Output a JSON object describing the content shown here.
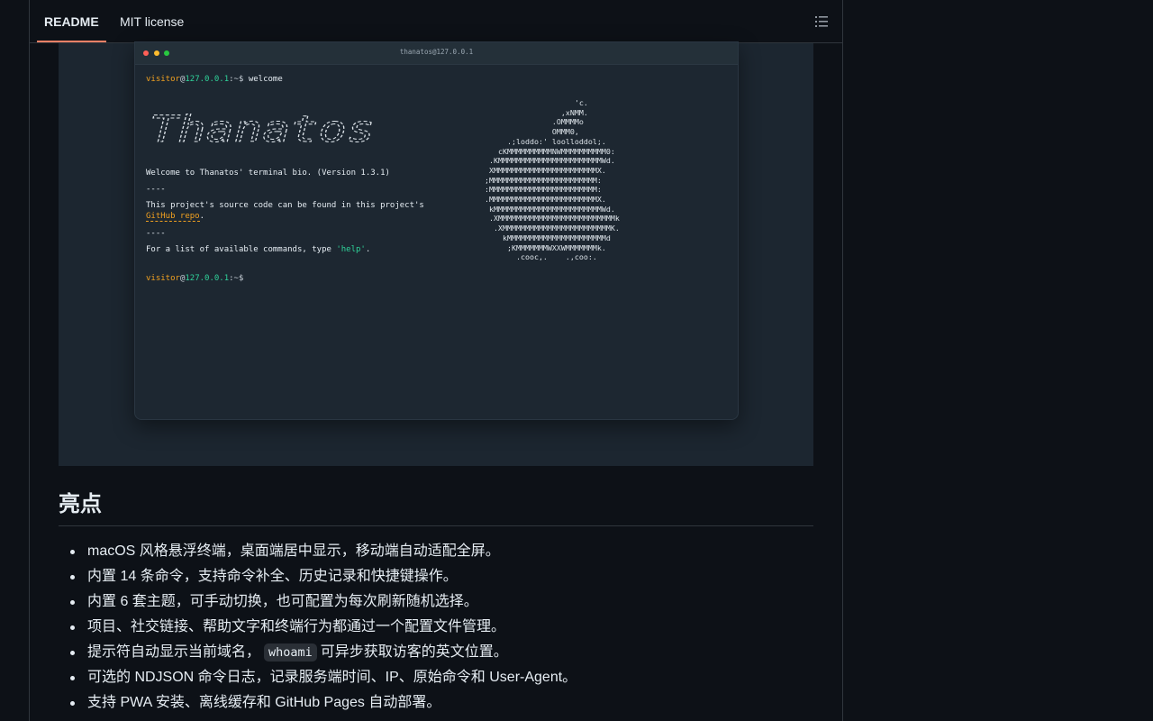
{
  "tabs": {
    "readme": "README",
    "license": "MIT license"
  },
  "terminal": {
    "title": "thanatos@127.0.0.1",
    "prompt_user": "visitor",
    "prompt_at": "@",
    "prompt_host": "127.0.0.1",
    "prompt_path": ":~$",
    "command": "welcome",
    "logo_text": "Thanatos",
    "welcome_line": "Welcome to Thanatos' terminal bio. (Version 1.3.1)",
    "separator": "----",
    "source_line": "This project's source code can be found in this project's",
    "github_link": "GitHub repo",
    "period": ".",
    "help_prefix": "For a list of available commands, type ",
    "help_cmd": "'help'",
    "help_suffix": ".",
    "apple_art": "                    'c.\n                 ,xNMM.\n               .OMMMMo\n               OMMM0,\n     .;loddo:' loolloddol;.\n   cKMMMMMMMMMMNWMMMMMMMMMM0:\n .KMMMMMMMMMMMMMMMMMMMMMMMWd.\n XMMMMMMMMMMMMMMMMMMMMMMMX.\n;MMMMMMMMMMMMMMMMMMMMMMMM:\n:MMMMMMMMMMMMMMMMMMMMMMMM:\n.MMMMMMMMMMMMMMMMMMMMMMMMX.\n kMMMMMMMMMMMMMMMMMMMMMMMMWd.\n .XMMMMMMMMMMMMMMMMMMMMMMMMMMk\n  .XMMMMMMMMMMMMMMMMMMMMMMMMK.\n    kMMMMMMMMMMMMMMMMMMMMMMd\n     ;KMMMMMMMWXXWMMMMMMMk.\n       .cooc,.    .,coo:."
  },
  "section": {
    "heading": "亮点"
  },
  "features": [
    {
      "text": "macOS 风格悬浮终端，桌面端居中显示，移动端自动适配全屏。"
    },
    {
      "text": "内置 14 条命令，支持命令补全、历史记录和快捷键操作。"
    },
    {
      "text": "内置 6 套主题，可手动切换，也可配置为每次刷新随机选择。"
    },
    {
      "text": "项目、社交链接、帮助文字和终端行为都通过一个配置文件管理。"
    },
    {
      "pre": "提示符自动显示当前域名，",
      "code": "whoami",
      "post": "可异步获取访客的英文位置。"
    },
    {
      "text": "可选的 NDJSON 命令日志，记录服务端时间、IP、原始命令和 User-Agent。"
    },
    {
      "text": "支持 PWA 安装、离线缓存和 GitHub Pages 自动部署。"
    }
  ],
  "icons": {
    "outline": "list-unordered-icon"
  },
  "colors": {
    "background": "#0d1117",
    "tab_accent": "#f78166",
    "prompt_user": "#f0a020",
    "prompt_host": "#2fd39a",
    "terminal_bg": "#1d2731"
  }
}
